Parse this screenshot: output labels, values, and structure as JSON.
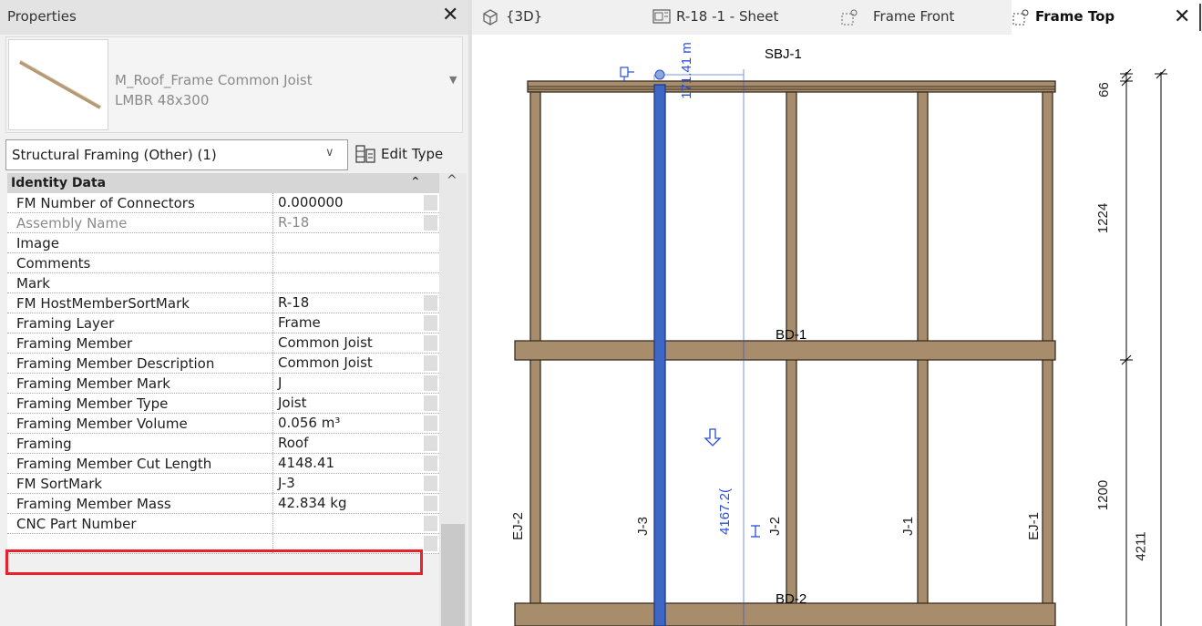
{
  "properties": {
    "title": "Properties",
    "type_name_line1": "M_Roof_Frame Common Joist",
    "type_name_line2": "LMBR 48x300",
    "filter_label": "Structural Framing (Other) (1)",
    "edit_type_label": "Edit Type",
    "group_label": "Identity Data",
    "rows": [
      {
        "name": "FM Number of Connectors",
        "value": "0.000000"
      },
      {
        "name": "Assembly Name",
        "value": "R-18"
      },
      {
        "name": "Image",
        "value": ""
      },
      {
        "name": "Comments",
        "value": ""
      },
      {
        "name": "Mark",
        "value": ""
      },
      {
        "name": "FM HostMemberSortMark",
        "value": "R-18"
      },
      {
        "name": "Framing Layer",
        "value": "Frame"
      },
      {
        "name": "Framing Member",
        "value": "Common Joist"
      },
      {
        "name": "Framing Member Description",
        "value": "Common Joist"
      },
      {
        "name": "Framing Member Mark",
        "value": "J"
      },
      {
        "name": "Framing Member Type",
        "value": "Joist"
      },
      {
        "name": "Framing Member Volume",
        "value": "0.056 m³"
      },
      {
        "name": "Framing",
        "value": "Roof"
      },
      {
        "name": "Framing Member Cut Length",
        "value": "4148.41"
      },
      {
        "name": "FM SortMark",
        "value": "J-3"
      },
      {
        "name": "Framing Member Mass",
        "value": "42.834 kg"
      },
      {
        "name": "CNC Part Number",
        "value": ""
      }
    ]
  },
  "tabs": {
    "t1": "{3D}",
    "t2": "R-18 -1 - Sheet",
    "t3": "Frame Front",
    "t4": "Frame Top"
  },
  "drawing": {
    "members": {
      "sbj": "SBJ-1",
      "bd1": "BD-1",
      "bd2": "BD-2",
      "ej2": "EJ-2",
      "j3": "J-3",
      "j2": "J-2",
      "j1": "J-1",
      "ej1": "EJ-1"
    },
    "temp_dims": {
      "top": "171.41 m",
      "length": "4167.2("
    },
    "dims": {
      "d66": "66",
      "d1224": "1224",
      "d1200": "1200",
      "d4211": "4211"
    },
    "colors": {
      "wood": "#a88d6c",
      "selected": "#3e66c4",
      "temp_dim": "#2a4fd6"
    }
  }
}
